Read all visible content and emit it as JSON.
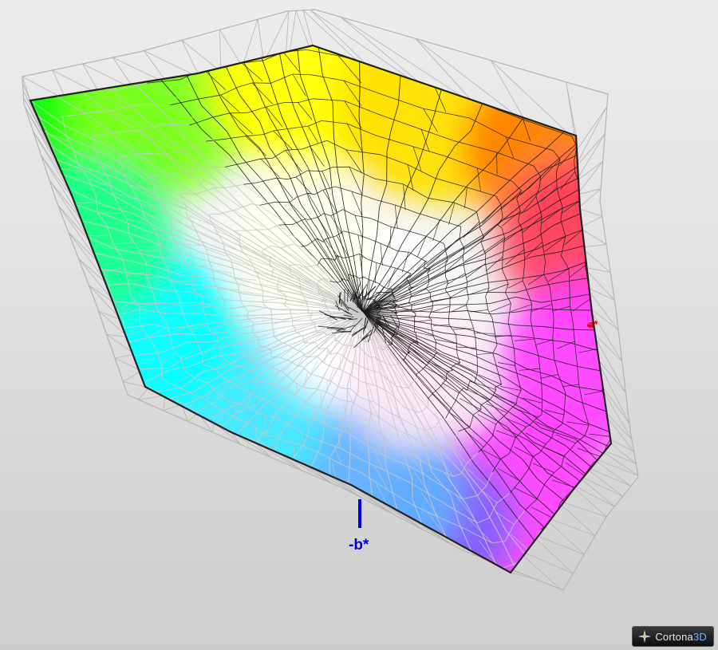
{
  "viewer": {
    "brand_name": "Cortona",
    "brand_suffix": "3D",
    "logo_icon": "cortona-star-icon"
  },
  "axes": {
    "a_label": "a*",
    "b_label": "-b*",
    "a_color": "#e00000",
    "b_color": "#0000e0"
  },
  "gamut": {
    "corner_colors": {
      "green": "#00ff00",
      "yellow": "#ffff00",
      "orange": "#ff7f00",
      "red": "#ff4060",
      "magenta": "#ff40ff",
      "blue": "#8060ff",
      "cyan": "#00ffff",
      "white": "#ffffff"
    },
    "mesh_dark": "#1a1a1a",
    "mesh_light": "#c8c8c8",
    "wire_outer": "#b4b4b4"
  }
}
